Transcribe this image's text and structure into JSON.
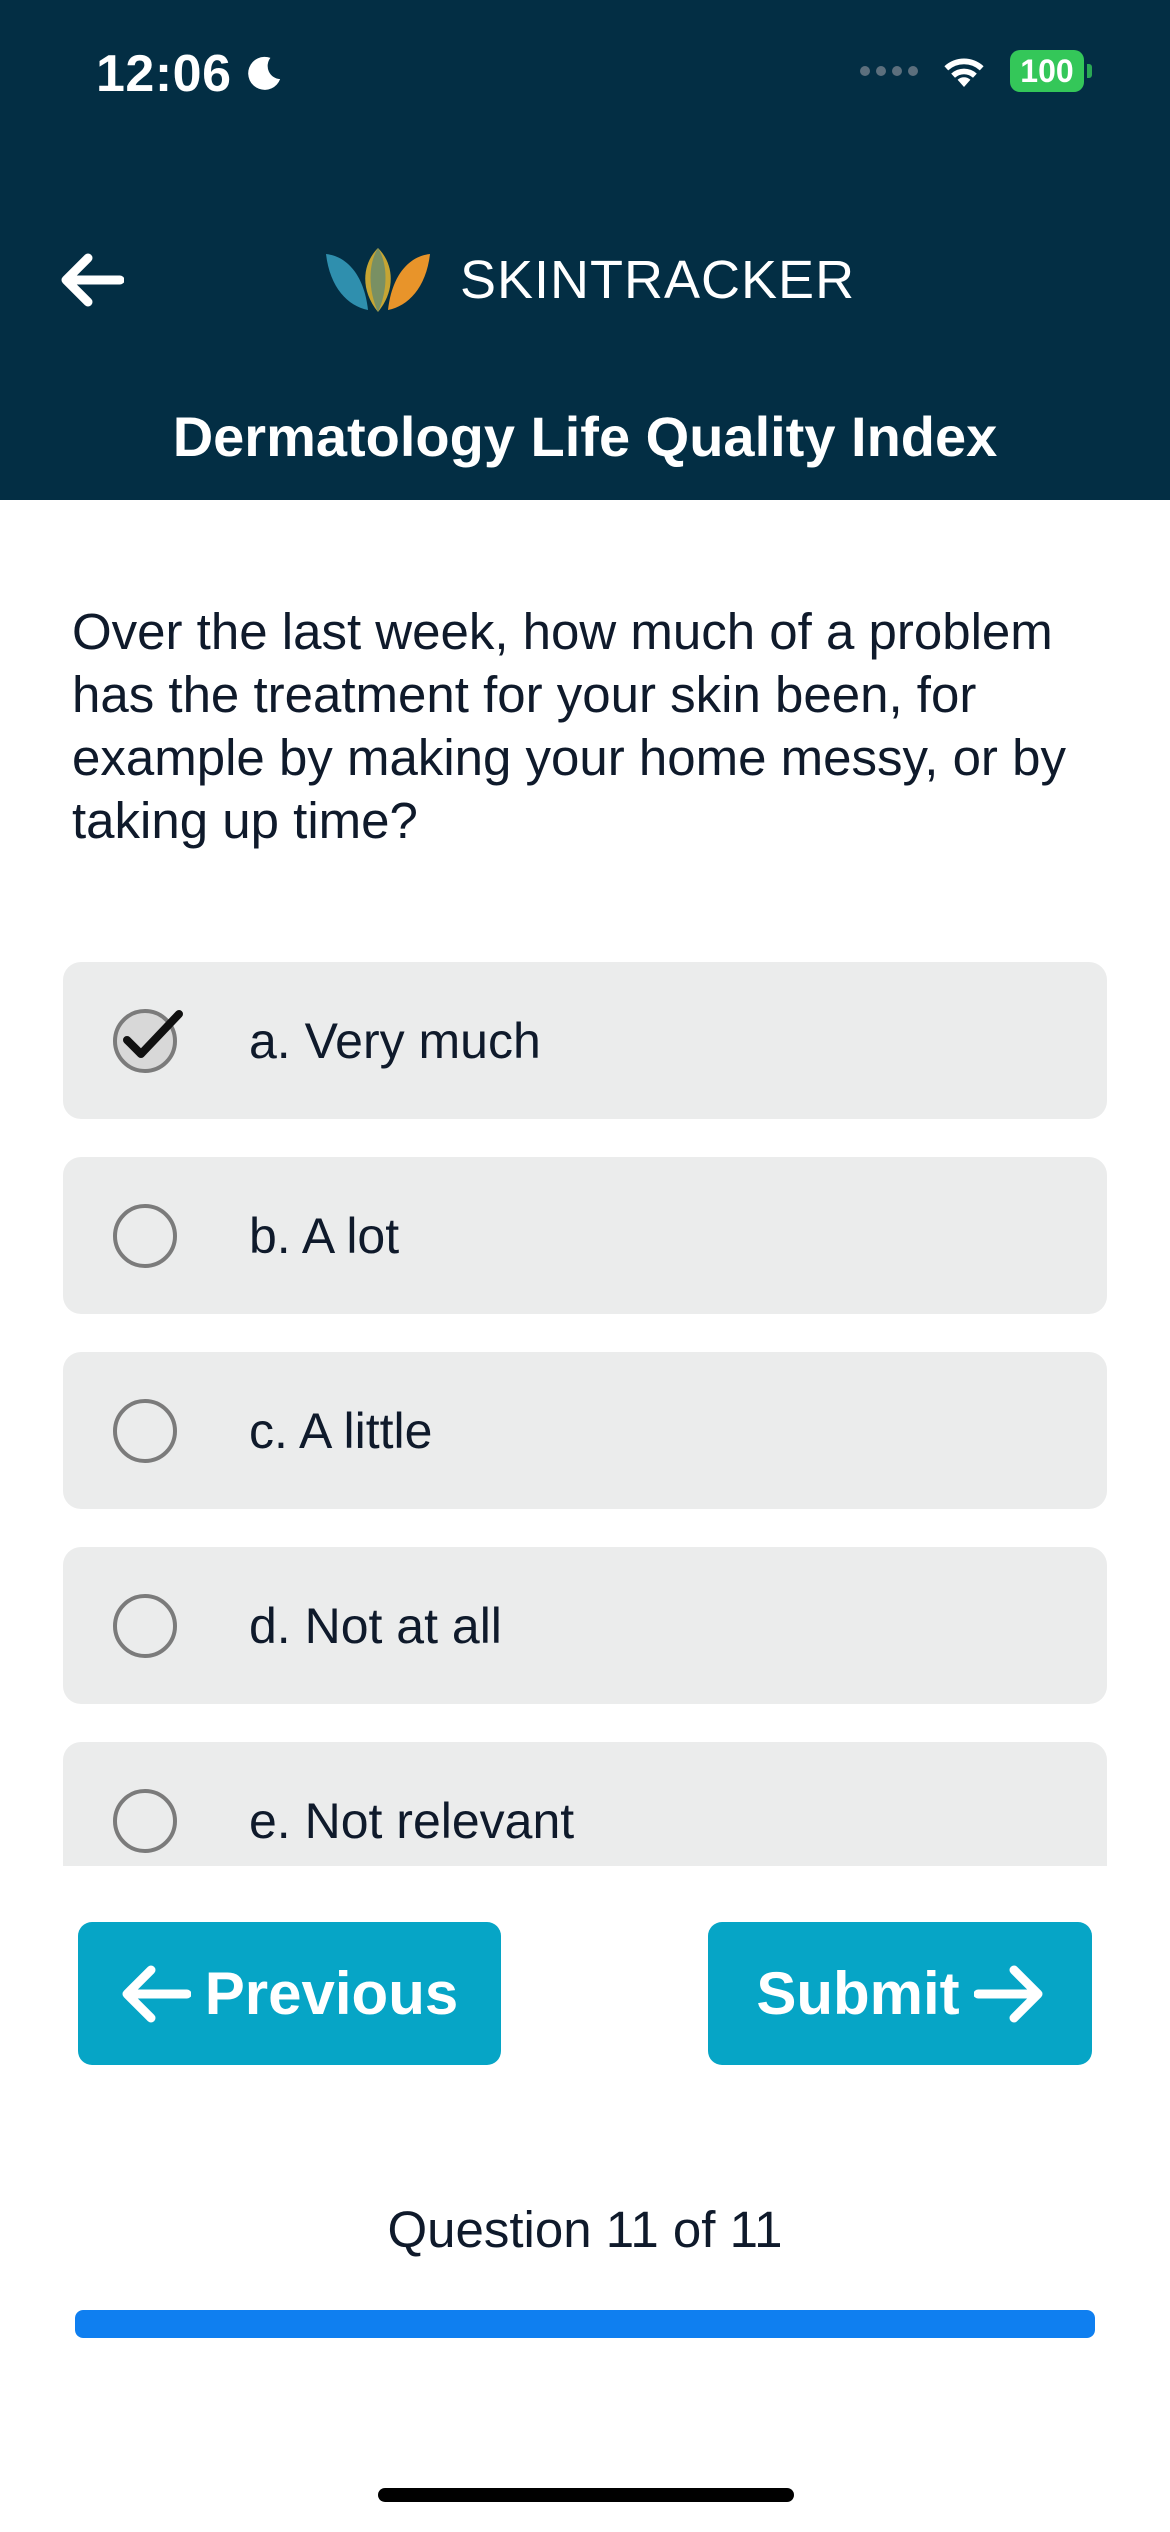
{
  "status_bar": {
    "time": "12:06",
    "battery": "100",
    "icons": [
      "moon-icon",
      "signal-icon",
      "wifi-icon",
      "battery-icon"
    ]
  },
  "header": {
    "back_icon": "arrow-left-icon",
    "brand_name": "SKINTRACKER",
    "title": "Dermatology Life Quality Index"
  },
  "question": {
    "text": "Over the last week, how much of a problem has the treatment for your skin been, for example by making your home messy, or by taking up time?"
  },
  "options": [
    {
      "label": "a. Very much",
      "selected": true
    },
    {
      "label": "b. A lot",
      "selected": false
    },
    {
      "label": "c. A little",
      "selected": false
    },
    {
      "label": "d. Not at all",
      "selected": false
    },
    {
      "label": "e. Not relevant",
      "selected": false
    }
  ],
  "navigation": {
    "previous_label": "Previous",
    "submit_label": "Submit"
  },
  "progress": {
    "text": "Question 11 of 11",
    "current": 11,
    "total": 11,
    "fraction": 1.0
  },
  "colors": {
    "header_bg": "#032e44",
    "button_bg": "#06a5c6",
    "progress_fill": "#0f7ff0",
    "option_bg": "#ebecec"
  }
}
